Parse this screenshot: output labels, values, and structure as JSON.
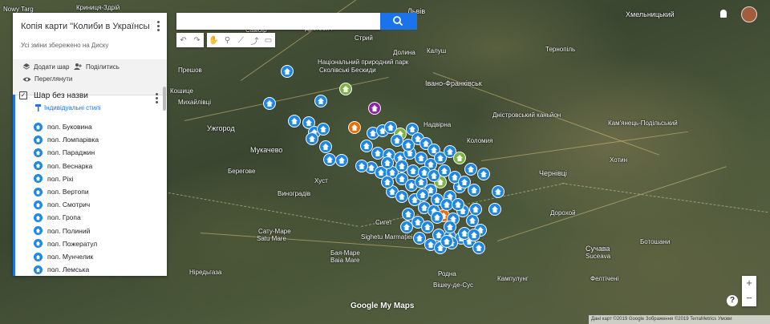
{
  "map_title": "Копія карти \"Колиби в Українськ...",
  "save_status": "Усі зміни збережено на Диску",
  "actions": {
    "add_layer": "Додати шар",
    "share": "Поділитись",
    "preview": "Переглянути"
  },
  "layer": {
    "name": "Шар без назви",
    "styles_link": "Індивідуальні стилі",
    "items": [
      "пол. Буковина",
      "пол. Ломпарівка",
      "пол. Параджин",
      "пол. Веснарка",
      "пол. Ріхі",
      "пол. Вертопи",
      "пол. Смотрич",
      "пол. Гропа",
      "пол. Полиний",
      "пол. Пожератул",
      "пол. Мунчелик",
      "пол. Лемська"
    ]
  },
  "footer": "Дані карт ©2019 Google Зображення ©2019 TerraMetrics   Умови",
  "logo": "Google My Maps",
  "zoom": {
    "in": "+",
    "out": "−"
  },
  "help": "?",
  "colors": {
    "marker_blue": "#1e88e5",
    "accent": "#1a73e8",
    "marker_orange": "#ef6c00",
    "marker_green": "#7cb342"
  },
  "map_labels": [
    {
      "t": "Nowy Targ"
    },
    {
      "t": "Криниця-Здрій"
    },
    {
      "t": "Львів"
    },
    {
      "t": "Хмельницький"
    },
    {
      "t": "Прешов"
    },
    {
      "t": "Кошице"
    },
    {
      "t": "Михайлівці"
    },
    {
      "t": "Ужгород"
    },
    {
      "t": "Мукачево"
    },
    {
      "t": "Берегове"
    },
    {
      "t": "Виноградів"
    },
    {
      "t": "Хуст"
    },
    {
      "t": "Сату-Маре"
    },
    {
      "t": "Satu Mare"
    },
    {
      "t": "Бая-Маре"
    },
    {
      "t": "Baia Mare"
    },
    {
      "t": "Сигет"
    },
    {
      "t": "Sighetu Marmației"
    },
    {
      "t": "Івано-Франківськ"
    },
    {
      "t": "Коломия"
    },
    {
      "t": "Надвірна"
    },
    {
      "t": "Чернівці"
    },
    {
      "t": "Тернопіль"
    },
    {
      "t": "Кам'янець-Подільський"
    },
    {
      "t": "Дністровський каньйон"
    },
    {
      "t": "Ботошани"
    },
    {
      "t": "Сучава"
    },
    {
      "t": "Suceava"
    },
    {
      "t": "Кампулунг"
    },
    {
      "t": "Фелтічені"
    },
    {
      "t": "Родна"
    },
    {
      "t": "Національний природний парк"
    },
    {
      "t": "Сколівські Бескиди"
    },
    {
      "t": "Стрий"
    },
    {
      "t": "Дрогобич"
    },
    {
      "t": "Самбір"
    },
    {
      "t": "Долина"
    },
    {
      "t": "Калуш"
    },
    {
      "t": "Ніредьгаза"
    },
    {
      "t": "Вішеу-де-Сус"
    },
    {
      "t": "Дорохой"
    },
    {
      "t": "Хотин"
    }
  ]
}
